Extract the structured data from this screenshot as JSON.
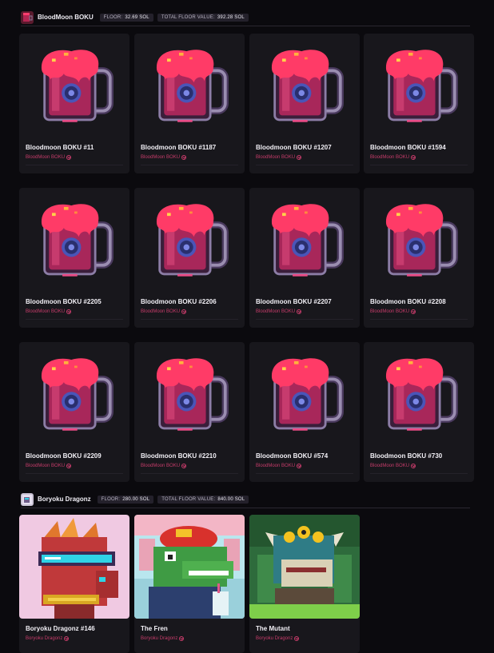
{
  "sections": [
    {
      "title": "BloodMoon BOKU",
      "floor_label": "FLOOR:",
      "floor_value": "32.69 SOL",
      "total_label": "TOTAL FLOOR VALUE:",
      "total_value": "392.28 SOL",
      "items": [
        {
          "name": "Bloodmoon BOKU #11",
          "collection": "BloodMoon BOKU"
        },
        {
          "name": "Bloodmoon BOKU #1187",
          "collection": "BloodMoon BOKU"
        },
        {
          "name": "Bloodmoon BOKU #1207",
          "collection": "BloodMoon BOKU"
        },
        {
          "name": "Bloodmoon BOKU #1594",
          "collection": "BloodMoon BOKU"
        },
        {
          "name": "Bloodmoon BOKU #2205",
          "collection": "BloodMoon BOKU"
        },
        {
          "name": "Bloodmoon BOKU #2206",
          "collection": "BloodMoon BOKU"
        },
        {
          "name": "Bloodmoon BOKU #2207",
          "collection": "BloodMoon BOKU"
        },
        {
          "name": "Bloodmoon BOKU #2208",
          "collection": "BloodMoon BOKU"
        },
        {
          "name": "Bloodmoon BOKU #2209",
          "collection": "BloodMoon BOKU"
        },
        {
          "name": "Bloodmoon BOKU #2210",
          "collection": "BloodMoon BOKU"
        },
        {
          "name": "Bloodmoon BOKU #574",
          "collection": "BloodMoon BOKU"
        },
        {
          "name": "Bloodmoon BOKU #730",
          "collection": "BloodMoon BOKU"
        }
      ]
    },
    {
      "title": "Boryoku Dragonz",
      "floor_label": "FLOOR:",
      "floor_value": "280.00 SOL",
      "total_label": "TOTAL FLOOR VALUE:",
      "total_value": "840.00 SOL",
      "items": [
        {
          "name": "Boryoku Dragonz #146",
          "collection": "Boryoku Dragonz"
        },
        {
          "name": "The Fren",
          "collection": "Boryoku Dragonz"
        },
        {
          "name": "The Mutant",
          "collection": "Boryoku Dragonz"
        }
      ]
    }
  ],
  "colors": {
    "background": "#0b0a0e",
    "card": "#18171c",
    "collection_link": "#c63c6a",
    "pill": "#24212b"
  },
  "icons": {
    "collection_badge": "bloodmoon-mug-icon",
    "collection_badge_2": "dragon-icon",
    "verified": "verified-check-icon"
  }
}
